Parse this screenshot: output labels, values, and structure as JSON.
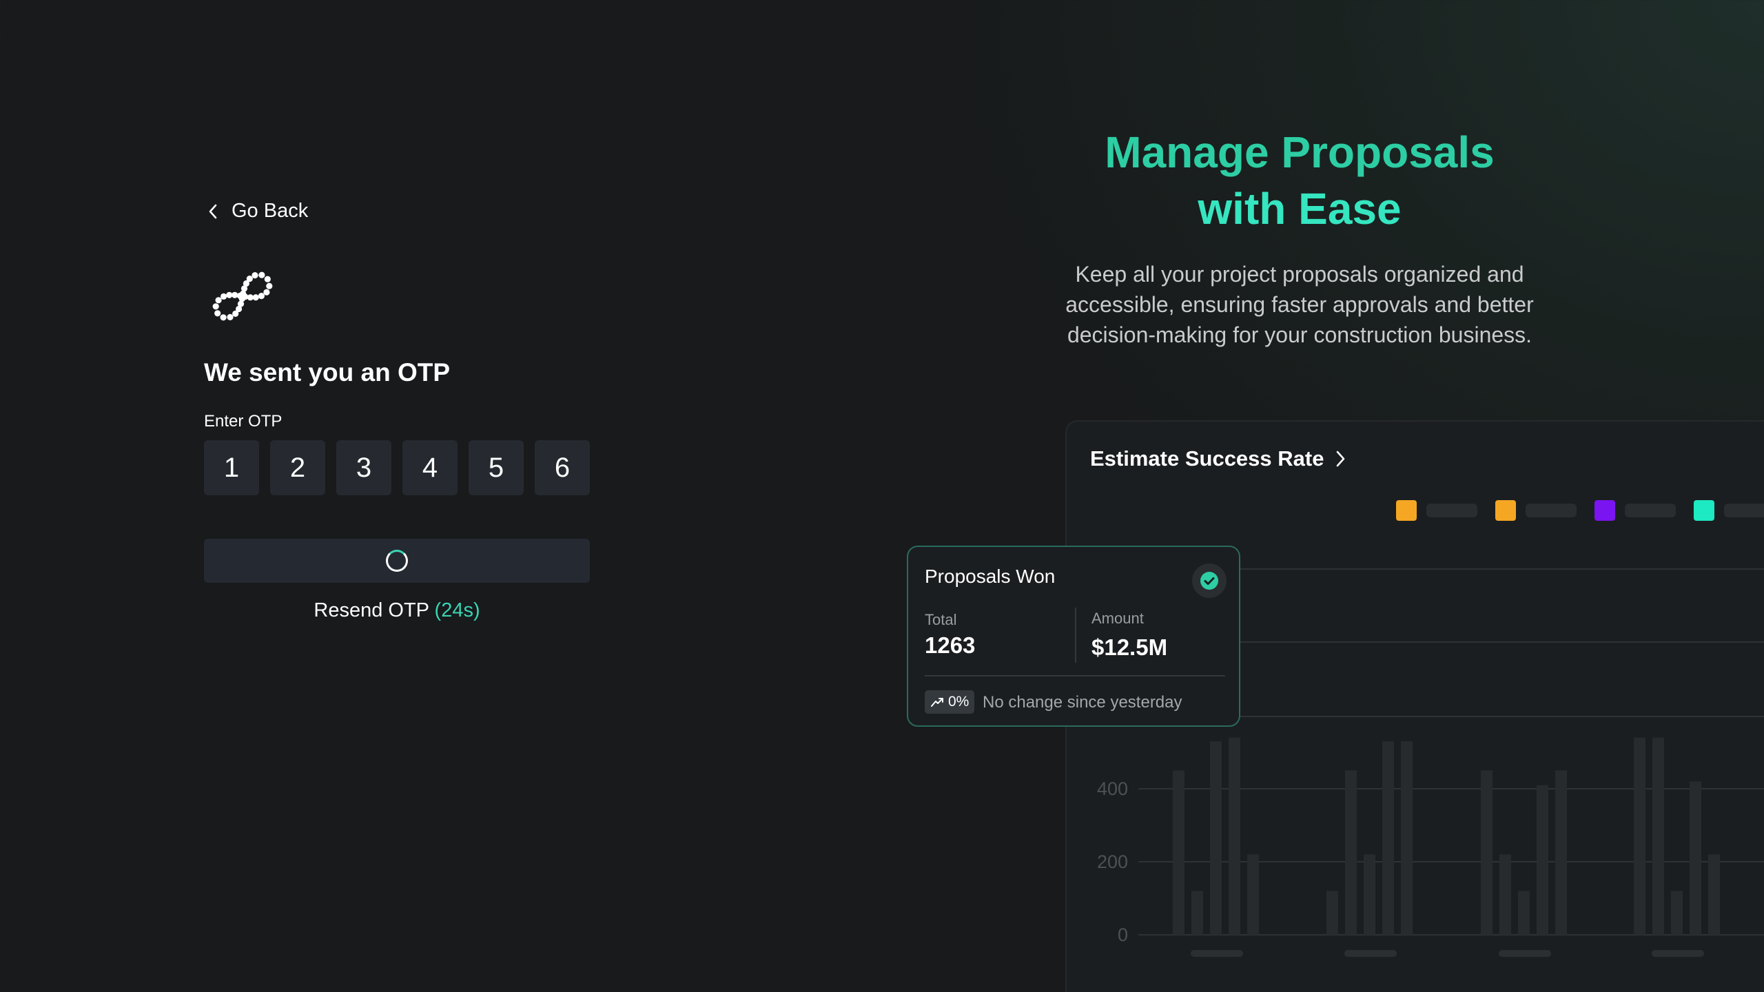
{
  "nav": {
    "go_back_label": "Go Back",
    "back_icon": "chevron-left-icon"
  },
  "logo": {
    "icon": "infinity-dots-logo"
  },
  "otp": {
    "title": "We sent you an OTP",
    "label": "Enter OTP",
    "digits": [
      "1",
      "2",
      "3",
      "4",
      "5",
      "6"
    ],
    "submit_state": "loading",
    "resend_label": "Resend OTP",
    "resend_timer": "(24s)"
  },
  "hero": {
    "title_line1": "Manage Proposals",
    "title_line2": "with Ease",
    "subtitle": "Keep all your project proposals organized and accessible, ensuring faster approvals and better decision-making for your construction business."
  },
  "panel": {
    "title": "Estimate Success Rate",
    "legend_colors": [
      "#f5a623",
      "#f5a623",
      "#7a14f0",
      "#1de9c2"
    ]
  },
  "chart_data": {
    "type": "bar",
    "title": "Estimate Success Rate",
    "xlabel": "",
    "ylabel": "",
    "yticks": [
      "0",
      "200",
      "400"
    ],
    "ylim": [
      0,
      800
    ],
    "groups": [
      {
        "values": [
          450,
          120,
          530,
          540,
          220
        ]
      },
      {
        "values": [
          120,
          450,
          220,
          530,
          530
        ]
      },
      {
        "values": [
          450,
          220,
          120,
          410,
          450
        ]
      },
      {
        "values": [
          540,
          540,
          120,
          420,
          220
        ]
      }
    ]
  },
  "card": {
    "title": "Proposals Won",
    "total_label": "Total",
    "total_value": "1263",
    "amount_label": "Amount",
    "amount_value": "$12.5M",
    "change_value": "0%",
    "change_text": "No change since yesterday",
    "accent": "#2dcea4"
  }
}
